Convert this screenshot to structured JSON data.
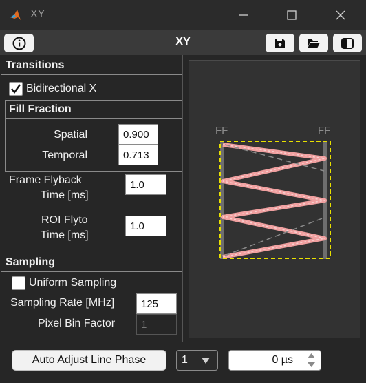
{
  "window": {
    "title": "XY"
  },
  "panel": {
    "title": "XY"
  },
  "toolbar": {
    "info_icon": "info-circle-icon",
    "save_icon": "save-icon",
    "open_icon": "folder-open-icon",
    "panel_toggle_icon": "panel-toggle-icon"
  },
  "transitions": {
    "header": "Transitions",
    "bidirectional_label": "Bidirectional X",
    "bidirectional_checked": true,
    "fill_fraction": {
      "header": "Fill Fraction",
      "spatial_label": "Spatial",
      "spatial_value": "0.900",
      "temporal_label": "Temporal",
      "temporal_value": "0.713"
    },
    "frame_flyback_label_1": "Frame Flyback",
    "frame_flyback_label_2": "Time [ms]",
    "frame_flyback_value": "1.0",
    "roi_flyto_label_1": "ROI Flyto",
    "roi_flyto_label_2": "Time [ms]",
    "roi_flyto_value": "1.0"
  },
  "sampling": {
    "header": "Sampling",
    "uniform_label": "Uniform Sampling",
    "uniform_checked": false,
    "rate_label": "Sampling Rate [MHz]",
    "rate_value": "125",
    "bin_label": "Pixel Bin Factor",
    "bin_value": "1"
  },
  "preview": {
    "ff_left": "FF",
    "ff_right": "FF",
    "scan_color": "#f0a0a0",
    "roi_color": "#e8e000"
  },
  "bottom": {
    "auto_adjust_label": "Auto Adjust Line Phase",
    "dropdown_value": "1",
    "phase_value": "0 µs"
  },
  "colors": {
    "background": "#262626",
    "titlebar": "#2b2b2b",
    "toolbar": "#3a3a3a",
    "accent": "#f0a0a0"
  }
}
